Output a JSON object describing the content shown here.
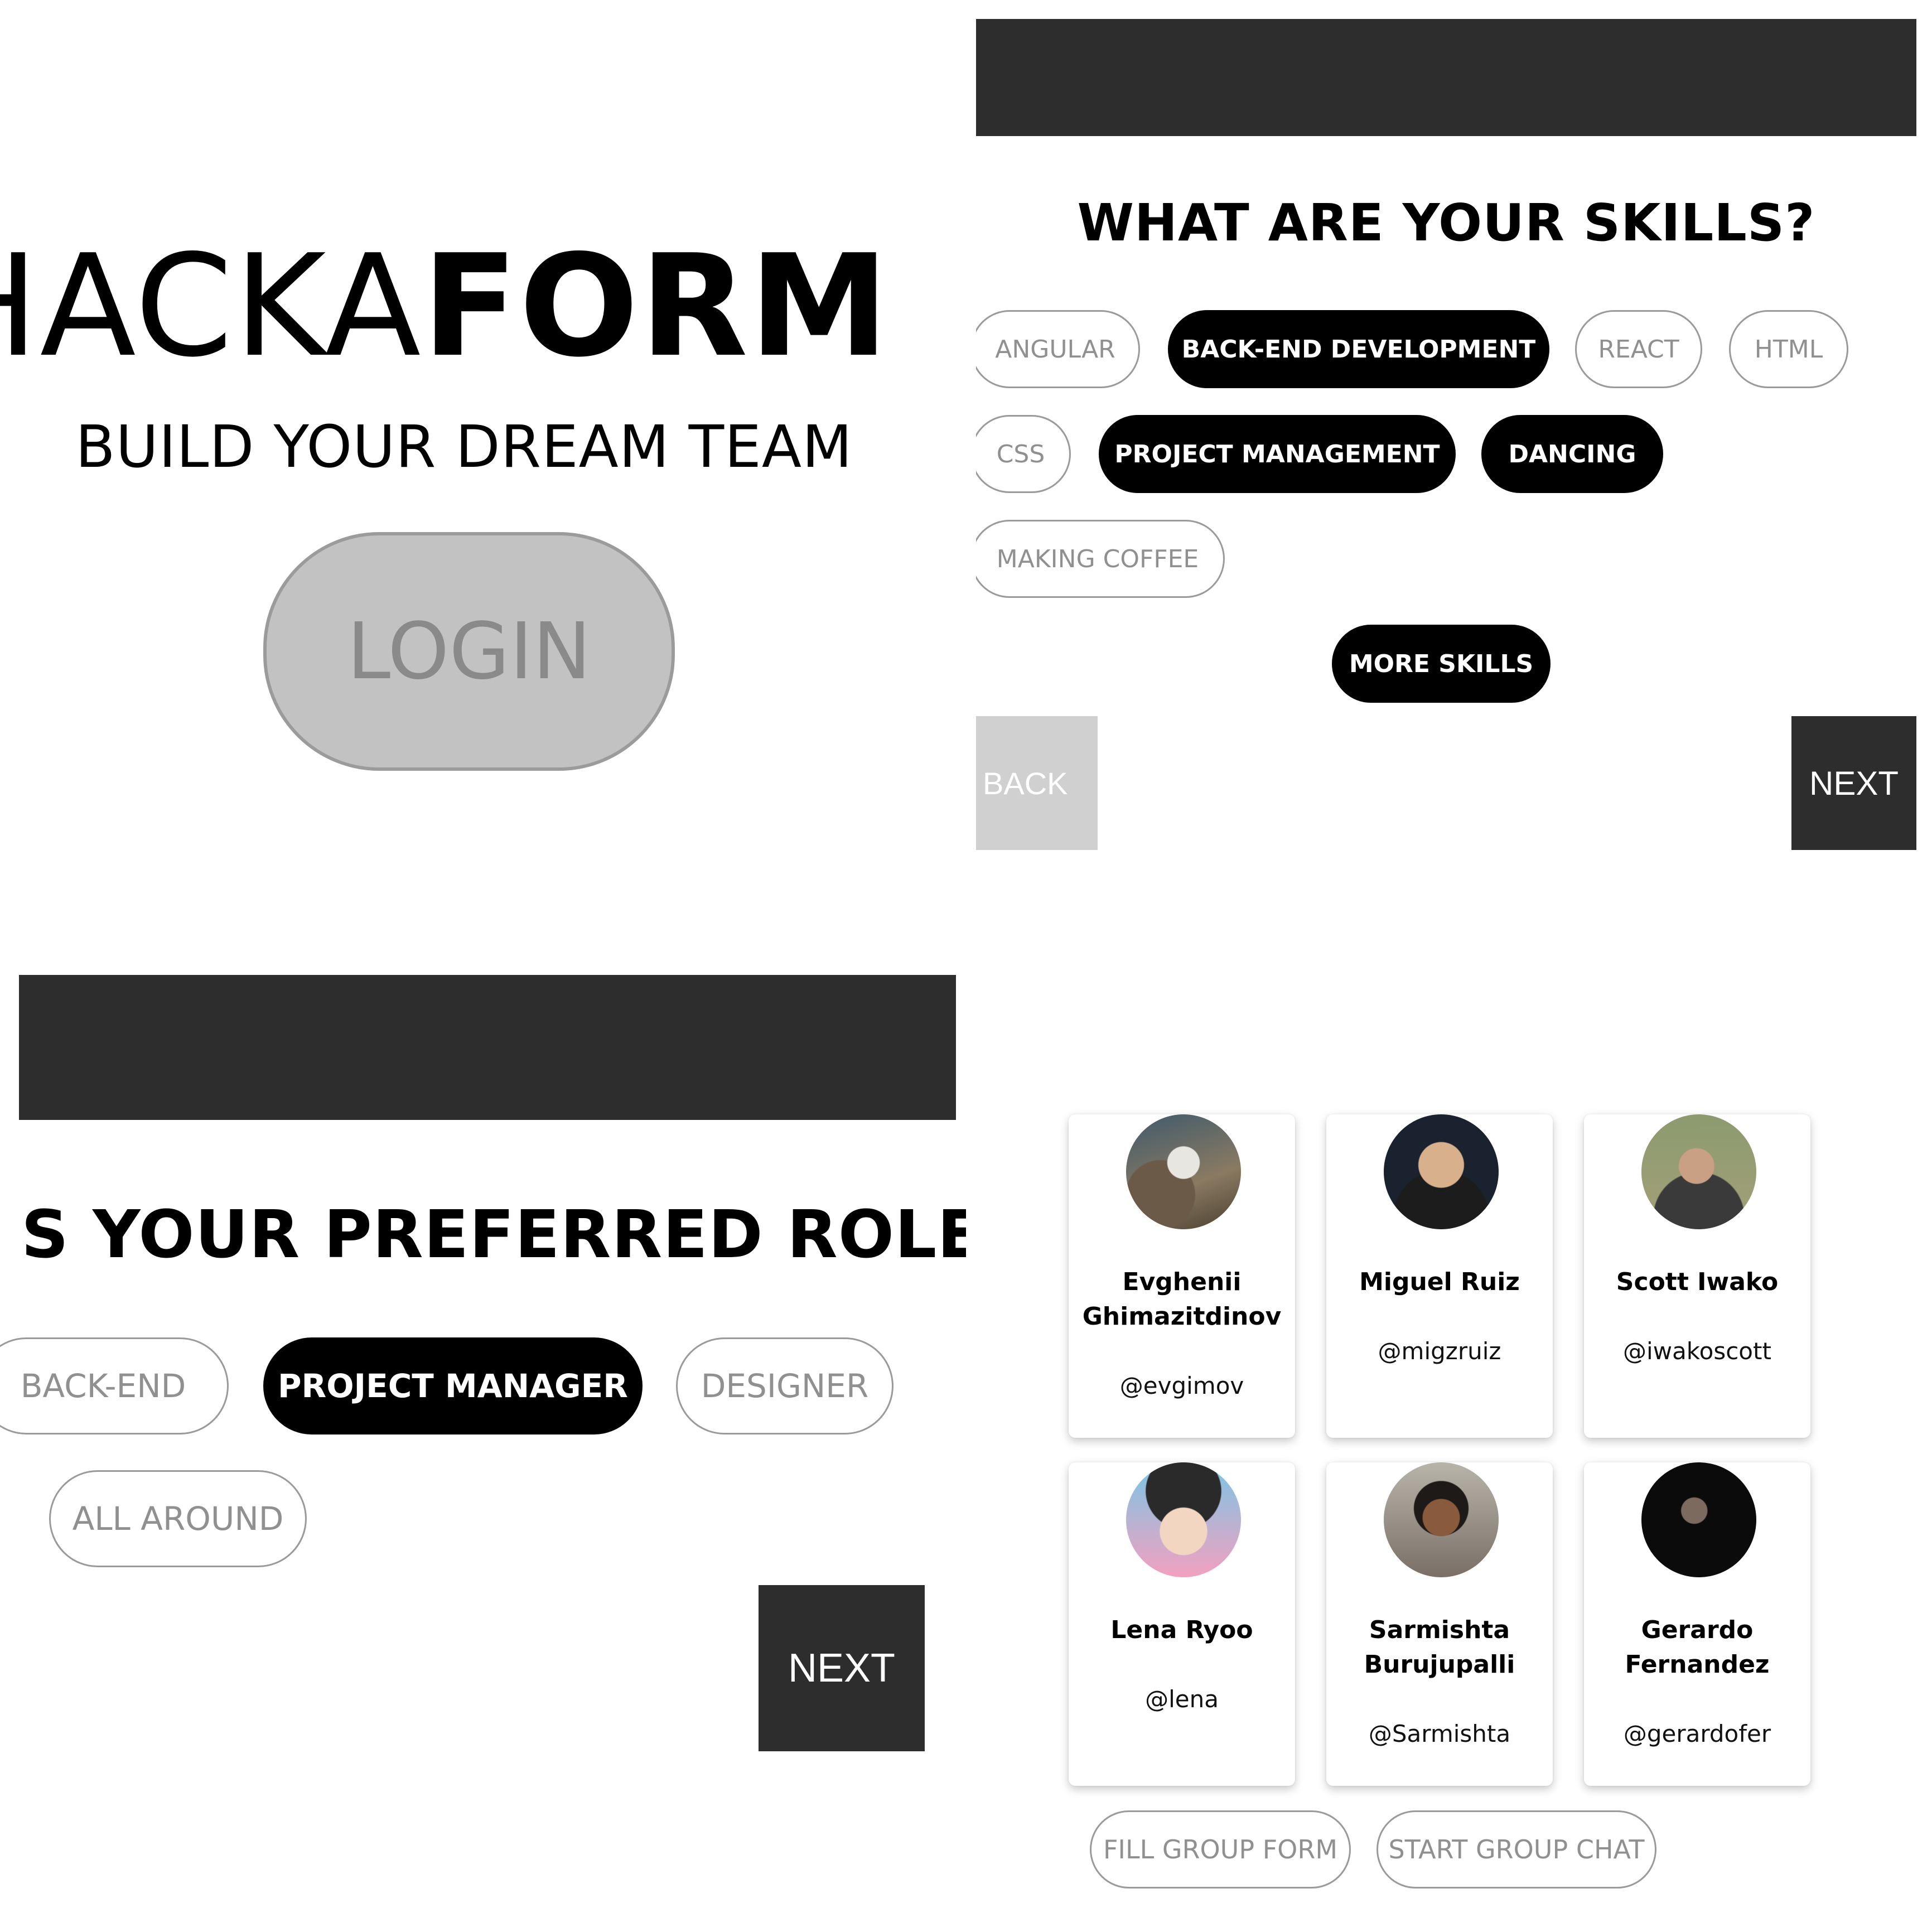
{
  "login_screen": {
    "logo_thin": "HACKA",
    "logo_bold": "FORM",
    "tagline": "BUILD YOUR DREAM TEAM",
    "login_label": "LOGIN"
  },
  "skills_screen": {
    "title": "WHAT ARE YOUR SKILLS?",
    "skills": [
      {
        "label": "ANGULAR",
        "selected": false
      },
      {
        "label": "BACK-END DEVELOPMENT",
        "selected": true
      },
      {
        "label": "REACT",
        "selected": false
      },
      {
        "label": "HTML",
        "selected": false
      },
      {
        "label": "CSS",
        "selected": false
      },
      {
        "label": "PROJECT MANAGEMENT",
        "selected": true
      },
      {
        "label": "DANCING",
        "selected": true
      },
      {
        "label": "MAKING COFFEE",
        "selected": false
      }
    ],
    "more_skills_label": "MORE SKILLS",
    "back_label": "BACK",
    "next_label": "NEXT"
  },
  "role_screen": {
    "title": "S YOUR PREFERRED ROLE?",
    "roles": [
      {
        "label": "BACK-END",
        "selected": false
      },
      {
        "label": "PROJECT MANAGER",
        "selected": true
      },
      {
        "label": "DESIGNER",
        "selected": false
      },
      {
        "label": "ALL AROUND",
        "selected": false
      }
    ],
    "next_label": "NEXT"
  },
  "team_screen": {
    "members": [
      {
        "name": "Evghenii Ghimazitdinov",
        "handle": "@evgimov"
      },
      {
        "name": "Miguel Ruiz",
        "handle": "@migzruiz"
      },
      {
        "name": "Scott Iwako",
        "handle": "@iwakoscott"
      },
      {
        "name": "Lena Ryoo",
        "handle": "@lena"
      },
      {
        "name": "Sarmishta Burujupalli",
        "handle": "@Sarmishta"
      },
      {
        "name": "Gerardo Fernandez",
        "handle": "@gerardofer"
      }
    ],
    "fill_group_form_label": "FILL GROUP FORM",
    "start_group_chat_label": "START GROUP CHAT"
  },
  "colors": {
    "dark_bar": "#2d2d2d",
    "selected_pill": "#000000",
    "unselected_border": "#9a9a9a",
    "login_fill": "#c2c2c2",
    "back_button": "#d0d0d0"
  }
}
